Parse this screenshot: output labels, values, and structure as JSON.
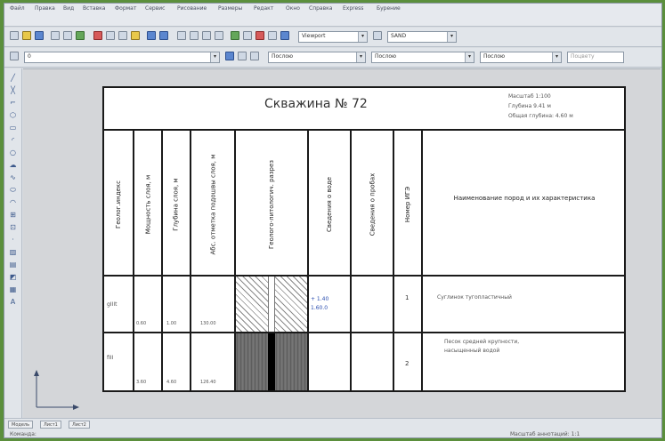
{
  "menus": [
    "Файл",
    "Правка",
    "Вид",
    "Вставка",
    "Формат",
    "Сервис",
    "Рисование",
    "Размеры",
    "Редакт",
    "Окно",
    "Справка",
    "Express",
    "Бурение"
  ],
  "toolbar": {
    "view_combo": "Viewport",
    "style_combo": "SAND",
    "layer_combo": "0",
    "color_combo": "Послою",
    "linetype_combo": "Послою",
    "lineweight_combo": "Послою",
    "plot_style": "Поцвету"
  },
  "sheet": {
    "title": "Скважина № 72",
    "info_lines": [
      "Масштаб 1:100",
      "Глубина 9.41 м",
      "Общая глубина: 4.60 м"
    ],
    "column_headers": [
      "Геолог.индекс",
      "Мощность слоя, м",
      "Глубина слоя, м",
      "Абс. отметка подошвы слоя, м",
      "Геолого-литологич. разрез",
      "Сведения о воде",
      "Сведения о пробах",
      "Номер ИГЭ",
      "Наименование пород и их характеристика"
    ],
    "rows": [
      {
        "index": "gIIIt",
        "thickness": "0.60",
        "depth": "1.00",
        "abs_mark": "130.00",
        "water": [
          "+ 1.40",
          "1.60.0"
        ],
        "ige": "1",
        "description": [
          "Суглинок тугопластичный"
        ]
      },
      {
        "index": "fIII",
        "thickness": "3.60",
        "depth": "4.60",
        "abs_mark": "126.40",
        "water": [],
        "ige": "2",
        "description": [
          "Песок средней крупности,",
          "насыщенный водой"
        ]
      }
    ]
  },
  "layout_tabs": [
    "Модель",
    "Лист1",
    "Лист2"
  ],
  "status": {
    "command_prompt": "Команда:",
    "right_info": "Масштаб аннотаций: 1:1"
  }
}
